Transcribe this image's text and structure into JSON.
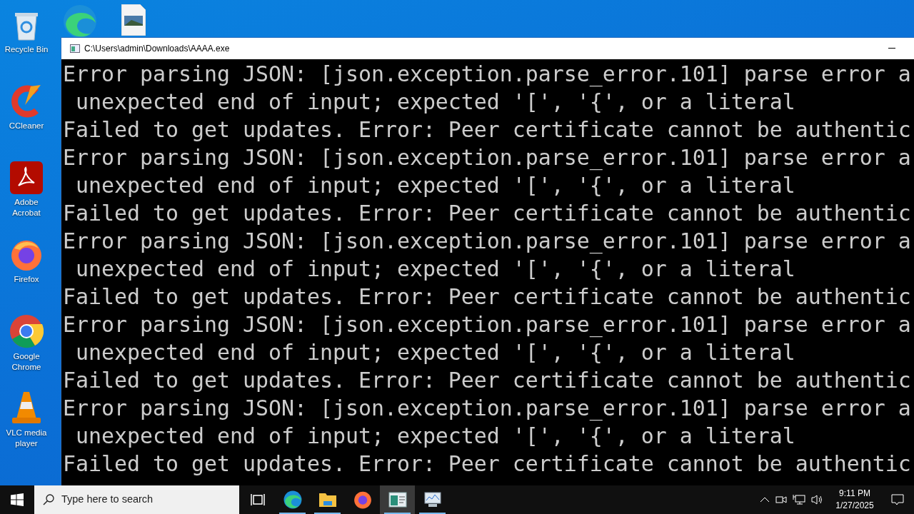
{
  "desktop": {
    "icons": [
      {
        "kind": "recycle",
        "label": "Recycle Bin"
      },
      {
        "kind": "ccleaner",
        "label": "CCleaner"
      },
      {
        "kind": "acrobat",
        "label": "Adobe Acrobat"
      },
      {
        "kind": "firefox",
        "label": "Firefox"
      },
      {
        "kind": "chrome",
        "label": "Google Chrome"
      },
      {
        "kind": "vlc",
        "label": "VLC media player"
      }
    ],
    "partial_icons": [
      {
        "kind": "edge"
      },
      {
        "kind": "image"
      }
    ]
  },
  "window": {
    "title": "C:\\Users\\admin\\Downloads\\AAAA.exe",
    "lines": [
      "Error parsing JSON: [json.exception.parse_error.101] parse error a",
      " unexpected end of input; expected '[', '{', or a literal",
      "Failed to get updates. Error: Peer certificate cannot be authentic",
      "Error parsing JSON: [json.exception.parse_error.101] parse error a",
      " unexpected end of input; expected '[', '{', or a literal",
      "Failed to get updates. Error: Peer certificate cannot be authentic",
      "Error parsing JSON: [json.exception.parse_error.101] parse error a",
      " unexpected end of input; expected '[', '{', or a literal",
      "Failed to get updates. Error: Peer certificate cannot be authentic",
      "Error parsing JSON: [json.exception.parse_error.101] parse error a",
      " unexpected end of input; expected '[', '{', or a literal",
      "Failed to get updates. Error: Peer certificate cannot be authentic",
      "Error parsing JSON: [json.exception.parse_error.101] parse error a",
      " unexpected end of input; expected '[', '{', or a literal",
      "Failed to get updates. Error: Peer certificate cannot be authentic"
    ]
  },
  "taskbar": {
    "search_placeholder": "Type here to search",
    "apps": [
      {
        "kind": "taskview",
        "running": false,
        "selected": false
      },
      {
        "kind": "edge",
        "running": true,
        "selected": false
      },
      {
        "kind": "explorer",
        "running": true,
        "selected": false
      },
      {
        "kind": "firefox",
        "running": false,
        "selected": false
      },
      {
        "kind": "console",
        "running": true,
        "selected": true
      },
      {
        "kind": "monitor",
        "running": true,
        "selected": false
      }
    ],
    "time": "9:11 PM",
    "date": "1/27/2025"
  }
}
